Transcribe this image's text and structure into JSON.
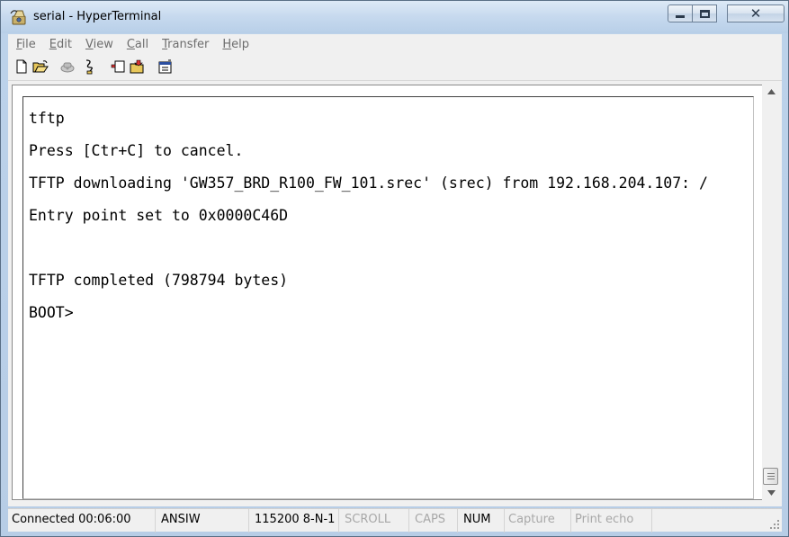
{
  "window": {
    "title": "serial - HyperTerminal",
    "close_glyph": "✕"
  },
  "menu": {
    "items": [
      {
        "accel": "F",
        "rest": "ile"
      },
      {
        "accel": "E",
        "rest": "dit"
      },
      {
        "accel": "V",
        "rest": "iew"
      },
      {
        "accel": "C",
        "rest": "all"
      },
      {
        "accel": "T",
        "rest": "ransfer"
      },
      {
        "accel": "H",
        "rest": "elp"
      }
    ]
  },
  "toolbar": {
    "icons": [
      "new-connection-icon",
      "open-icon",
      "connect-icon",
      "disconnect-icon",
      "send-icon",
      "receive-icon",
      "properties-icon"
    ]
  },
  "terminal": {
    "lines": [
      "tftp",
      "Press [Ctr+C] to cancel.",
      "TFTP downloading 'GW357_BRD_R100_FW_101.srec' (srec) from 192.168.204.107: /",
      "Entry point set to 0x0000C46D",
      "",
      "TFTP completed (798794 bytes)",
      "BOOT>"
    ]
  },
  "status": {
    "connected": "Connected 00:06:00",
    "emulation": "ANSIW",
    "port_settings": "115200 8-N-1",
    "scroll": "SCROLL",
    "caps": "CAPS",
    "num": "NUM",
    "capture": "Capture",
    "print_echo": "Print echo"
  },
  "colors": {
    "title_gradient_top": "#dde9f6",
    "frame": "#b7cde6",
    "status_dim": "#a8a8a8"
  }
}
